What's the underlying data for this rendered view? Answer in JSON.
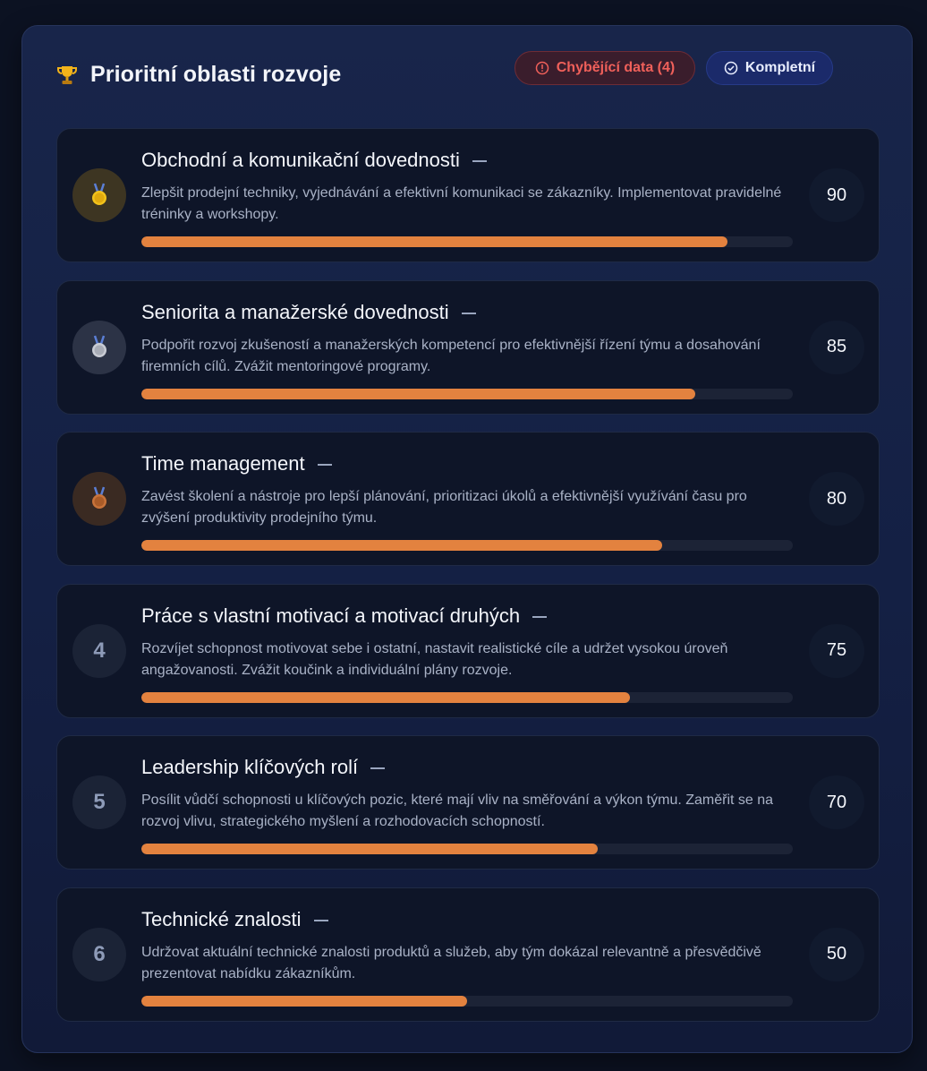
{
  "header": {
    "title": "Prioritní oblasti rozvoje",
    "icon": "trophy-icon",
    "badge_missing": "Chybějící data (4)",
    "badge_complete": "Kompletní"
  },
  "colors": {
    "accent_bar": "#e3823f",
    "missing_badge": "#f0605a",
    "complete_badge_bg": "#1b2a6a"
  },
  "areas": [
    {
      "rank": "1",
      "rank_icon": "gold-medal-icon",
      "title": "Obchodní a komunikační dovednosti",
      "description": "Zlepšit prodejní techniky, vyjednávání a efektivní komunikaci se zákazníky. Implementovat pravidelné tréninky a workshopy.",
      "score": "90",
      "progress_percent": 90
    },
    {
      "rank": "2",
      "rank_icon": "silver-medal-icon",
      "title": "Seniorita a manažerské dovednosti",
      "description": "Podpořit rozvoj zkušeností a manažerských kompetencí pro efektivnější řízení týmu a dosahování firemních cílů. Zvážit mentoringové programy.",
      "score": "85",
      "progress_percent": 85
    },
    {
      "rank": "3",
      "rank_icon": "bronze-medal-icon",
      "title": "Time management",
      "description": "Zavést školení a nástroje pro lepší plánování, prioritizaci úkolů a efektivnější využívání času pro zvýšení produktivity prodejního týmu.",
      "score": "80",
      "progress_percent": 80
    },
    {
      "rank": "4",
      "rank_icon": "",
      "title": "Práce s vlastní motivací a motivací druhých",
      "description": "Rozvíjet schopnost motivovat sebe i ostatní, nastavit realistické cíle a udržet vysokou úroveň angažovanosti. Zvážit koučink a individuální plány rozvoje.",
      "score": "75",
      "progress_percent": 75
    },
    {
      "rank": "5",
      "rank_icon": "",
      "title": "Leadership klíčových rolí",
      "description": "Posílit vůdčí schopnosti u klíčových pozic, které mají vliv na směřování a výkon týmu. Zaměřit se na rozvoj vlivu, strategického myšlení a rozhodovacích schopností.",
      "score": "70",
      "progress_percent": 70
    },
    {
      "rank": "6",
      "rank_icon": "",
      "title": "Technické znalosti",
      "description": "Udržovat aktuální technické znalosti produktů a služeb, aby tým dokázal relevantně a přesvědčivě prezentovat nabídku zákazníkům.",
      "score": "50",
      "progress_percent": 50
    }
  ]
}
